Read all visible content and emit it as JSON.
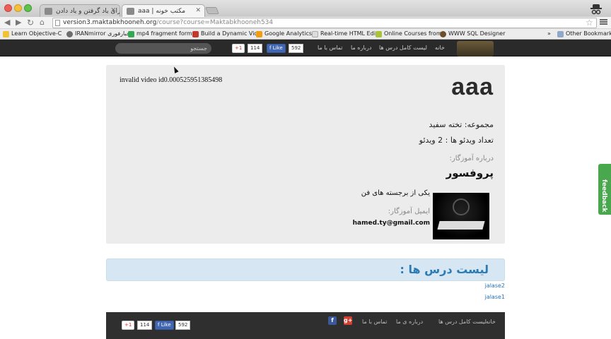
{
  "browser": {
    "tabs": [
      {
        "label": "خانه | جایی برای یاد گرفتن و یاد دادن"
      },
      {
        "label": "aaa | مکتب خونه"
      }
    ],
    "url_host": "version3.maktabkhooneh.org",
    "url_path": "/course?course=Maktabkhooneh534",
    "bookmarks": [
      {
        "label": "Learn Objective-C",
        "color": "#f1c232"
      },
      {
        "label": "IRANmirror اخبارفوری",
        "color": "#6d6d6d"
      },
      {
        "label": "mp4 fragment form",
        "color": "#34a853"
      },
      {
        "label": "Build a Dynamic Vid",
        "color": "#c0392b"
      },
      {
        "label": "Google Analytics",
        "color": "#f39c12"
      },
      {
        "label": "Real-time HTML Edi",
        "color": "#dddddd"
      },
      {
        "label": "Online Courses from",
        "color": "#a8c23a"
      },
      {
        "label": "WWW SQL Designer",
        "color": "#6b4f2a"
      }
    ],
    "bookmarks_overflow": "»",
    "other_bookmarks": "Other Bookmarks"
  },
  "site_nav": {
    "search_placeholder": "جستجو",
    "gplus_label": "+1",
    "gplus_count": "114",
    "fb_label": "Like",
    "fb_count": "592",
    "links": [
      "تماس با ما",
      "درباره ما",
      "لیست کامل درس ها",
      "خانه"
    ]
  },
  "course": {
    "video_message": "invalid video id0.000525951385498",
    "title": "aaa",
    "collection": "مجموعه: تخته سفید",
    "video_count": "تعداد ویدئو ها : 2 ویدئو",
    "about_teacher_label": "درباره آموزگار:",
    "teacher_name": "پروفسور",
    "teacher_bio": "یکی از برجسته های فن",
    "teacher_email_label": "ایمیل آموزگار:",
    "teacher_email": "hamed.ty@gmail.com"
  },
  "lessons": {
    "heading": "لیست درس ها :",
    "items": [
      "jalase2",
      "jalase1"
    ]
  },
  "footer": {
    "links": [
      "خانه",
      "لیست کامل درس ها",
      "درباره ی ما",
      "تماس با ما"
    ],
    "gplus_label": "+1",
    "gplus_count": "114",
    "fb_label": "Like",
    "fb_count": "592"
  },
  "feedback_label": "feedback"
}
